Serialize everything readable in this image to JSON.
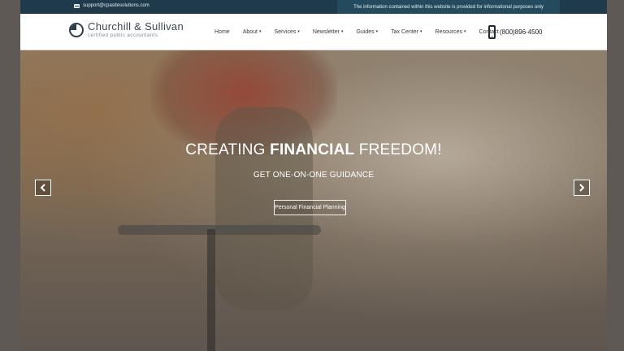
{
  "topbar": {
    "email": "support@cpasitesolutions.com",
    "notice": "The information contained within this website is provided for informational purposes only"
  },
  "brand": {
    "name": "Churchill & Sullivan",
    "tagline": "certified public accountants"
  },
  "nav": {
    "items": [
      {
        "label": "Home",
        "dropdown": false
      },
      {
        "label": "About",
        "dropdown": true
      },
      {
        "label": "Services",
        "dropdown": true
      },
      {
        "label": "Newsletter",
        "dropdown": true
      },
      {
        "label": "Guides",
        "dropdown": true
      },
      {
        "label": "Tax Center",
        "dropdown": true
      },
      {
        "label": "Resources",
        "dropdown": true
      },
      {
        "label": "Contact",
        "dropdown": false
      }
    ],
    "caret": "▾"
  },
  "phone": "(800)896-4500",
  "hero": {
    "title_part1": "CREATING ",
    "title_part2": "FINANCIAL",
    "title_part3": " FREEDOM!",
    "subtitle": "GET ONE-ON-ONE GUIDANCE",
    "button": "Personal Financial Planning"
  },
  "colors": {
    "topbar": "#1f3a4a",
    "notice_bg": "#234a5d",
    "brand": "#3b4852"
  }
}
